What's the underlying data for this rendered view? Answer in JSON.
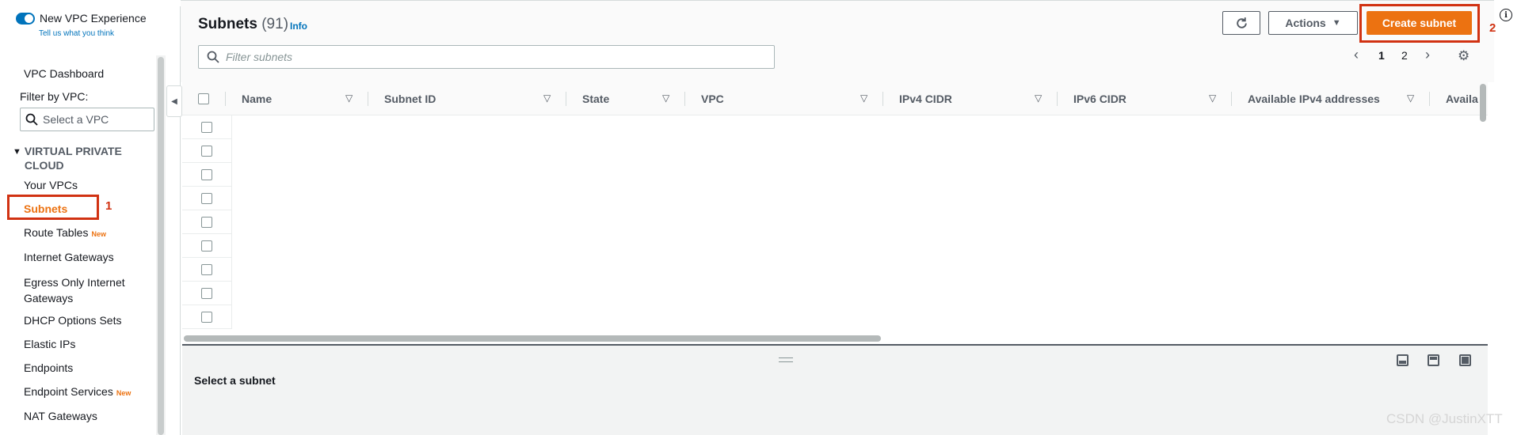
{
  "toggle": {
    "label": "New VPC Experience",
    "feedback": "Tell us what you think"
  },
  "sidenav": {
    "dashboard": "VPC Dashboard",
    "filter_label": "Filter by VPC:",
    "vpc_select_placeholder": "Select a VPC",
    "section": "VIRTUAL PRIVATE CLOUD",
    "items": [
      {
        "label": "Your VPCs",
        "badge": ""
      },
      {
        "label": "Subnets",
        "badge": "",
        "active": true
      },
      {
        "label": "Route Tables",
        "badge": "New"
      },
      {
        "label": "Internet Gateways",
        "badge": ""
      },
      {
        "label": "Egress Only Internet Gateways",
        "badge": ""
      },
      {
        "label": "DHCP Options Sets",
        "badge": ""
      },
      {
        "label": "Elastic IPs",
        "badge": ""
      },
      {
        "label": "Endpoints",
        "badge": ""
      },
      {
        "label": "Endpoint Services",
        "badge": "New"
      },
      {
        "label": "NAT Gateways",
        "badge": ""
      }
    ],
    "annotation_subnets": "1"
  },
  "header": {
    "title": "Subnets",
    "count": "(91)",
    "info": "Info",
    "actions_label": "Actions",
    "create_label": "Create subnet",
    "annotation_create": "2"
  },
  "search": {
    "placeholder": "Filter subnets"
  },
  "pagination": {
    "pages": [
      "1",
      "2"
    ],
    "current": "1"
  },
  "table": {
    "columns": [
      "Name",
      "Subnet ID",
      "State",
      "VPC",
      "IPv4 CIDR",
      "IPv6 CIDR",
      "Available IPv4 addresses",
      "Availa"
    ],
    "row_count": 9
  },
  "split_panel": {
    "title": "Select a subnet"
  },
  "watermark": "CSDN @JustinXTT",
  "colors": {
    "accent": "#ec7211",
    "link": "#0073bb",
    "annotation": "#d13212"
  },
  "icons": [
    "refresh-icon",
    "caret-down-icon",
    "search-icon",
    "gear-icon",
    "info-icon",
    "chevron-left-icon",
    "chevron-right-icon"
  ]
}
